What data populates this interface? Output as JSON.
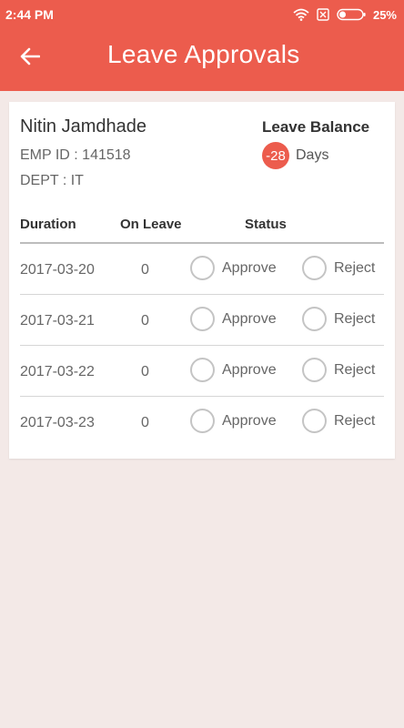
{
  "status_bar": {
    "time": "2:44 PM",
    "battery": "25%",
    "icons": [
      "wifi-icon",
      "sim-off-icon",
      "battery-icon"
    ]
  },
  "app_bar": {
    "title": "Leave Approvals",
    "back_icon": "arrow-left-icon"
  },
  "employee": {
    "name": "Nitin Jamdhade",
    "emp_id": "EMP ID : 141518",
    "dept": "DEPT : IT"
  },
  "leave_balance": {
    "title": "Leave Balance",
    "value": "-28",
    "unit": "Days"
  },
  "table": {
    "headers": {
      "duration": "Duration",
      "on_leave": "On Leave",
      "status": "Status"
    },
    "approve_label": "Approve",
    "reject_label": "Reject",
    "rows": [
      {
        "date": "2017-03-20",
        "on_leave": "0"
      },
      {
        "date": "2017-03-21",
        "on_leave": "0"
      },
      {
        "date": "2017-03-22",
        "on_leave": "0"
      },
      {
        "date": "2017-03-23",
        "on_leave": "0"
      }
    ]
  },
  "colors": {
    "accent": "#ec5c4d",
    "background": "#f3e9e7",
    "card": "#ffffff"
  }
}
